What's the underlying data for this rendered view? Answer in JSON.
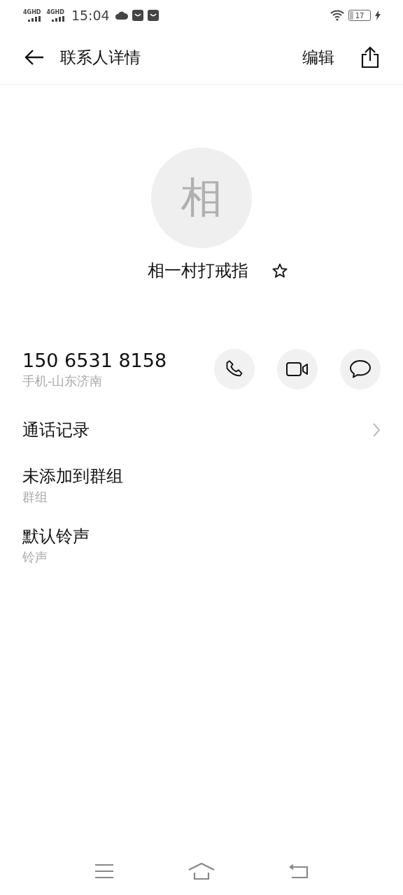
{
  "status_bar": {
    "signals": [
      "4GHD",
      "4GHD"
    ],
    "time": "15:04",
    "battery": "17"
  },
  "header": {
    "title": "联系人详情",
    "edit": "编辑"
  },
  "contact": {
    "avatar_letter": "相",
    "name": "相一村打戒指",
    "favorite": false
  },
  "phone": {
    "number": "150 6531 8158",
    "label": "手机-山东济南"
  },
  "rows": [
    {
      "kind": "link",
      "title": "通话记录"
    },
    {
      "kind": "info",
      "title": "未添加到群组",
      "subtitle": "群组"
    },
    {
      "kind": "info",
      "title": "默认铃声",
      "subtitle": "铃声"
    }
  ]
}
